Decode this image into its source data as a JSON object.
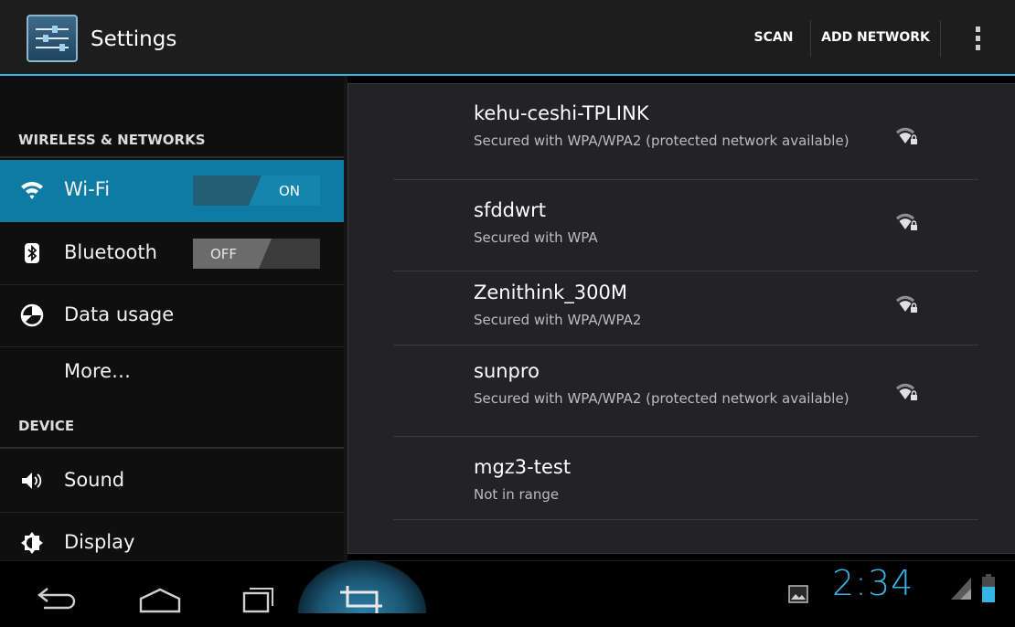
{
  "app": {
    "title": "Settings",
    "icon": "settings-sliders-icon"
  },
  "actionbar": {
    "scan_label": "SCAN",
    "add_network_label": "ADD NETWORK",
    "overflow_icon": "overflow-menu-icon"
  },
  "sidebar": {
    "sections": [
      {
        "header": "WIRELESS & NETWORKS",
        "items": [
          {
            "label": "Wi-Fi",
            "icon": "wifi-icon",
            "switch": "ON",
            "active": true
          },
          {
            "label": "Bluetooth",
            "icon": "bluetooth-icon",
            "switch": "OFF",
            "active": false
          },
          {
            "label": "Data usage",
            "icon": "data-usage-icon",
            "active": false
          },
          {
            "label": "More…",
            "icon": "",
            "active": false
          }
        ]
      },
      {
        "header": "DEVICE",
        "items": [
          {
            "label": "Sound",
            "icon": "sound-icon",
            "active": false
          },
          {
            "label": "Display",
            "icon": "display-brightness-icon",
            "active": false
          }
        ]
      }
    ]
  },
  "networks": [
    {
      "ssid": "kehu-ceshi-TPLINK",
      "summary": "Secured with WPA/WPA2 (protected network available)",
      "signal_icon": "wifi-signal-locked-icon",
      "in_range": true
    },
    {
      "ssid": "sfddwrt",
      "summary": "Secured with WPA",
      "signal_icon": "wifi-signal-locked-icon",
      "in_range": true
    },
    {
      "ssid": "Zenithink_300M",
      "summary": "Secured with WPA/WPA2",
      "signal_icon": "wifi-signal-locked-icon",
      "in_range": true
    },
    {
      "ssid": "sunpro",
      "summary": "Secured with WPA/WPA2 (protected network available)",
      "signal_icon": "wifi-signal-locked-icon",
      "in_range": true
    },
    {
      "ssid": "mgz3-test",
      "summary": "Not in range",
      "signal_icon": "",
      "in_range": false
    }
  ],
  "systembar": {
    "buttons": [
      "back-icon",
      "home-icon",
      "recent-apps-icon",
      "screenshot-icon"
    ],
    "notification_icon": "gallery-icon",
    "clock": "2:34",
    "status_icons": [
      "signal-icon",
      "battery-icon"
    ]
  },
  "colors": {
    "accent": "#33b5e5",
    "active_row": "#0e7ba2",
    "pane_bg": "#232327"
  }
}
